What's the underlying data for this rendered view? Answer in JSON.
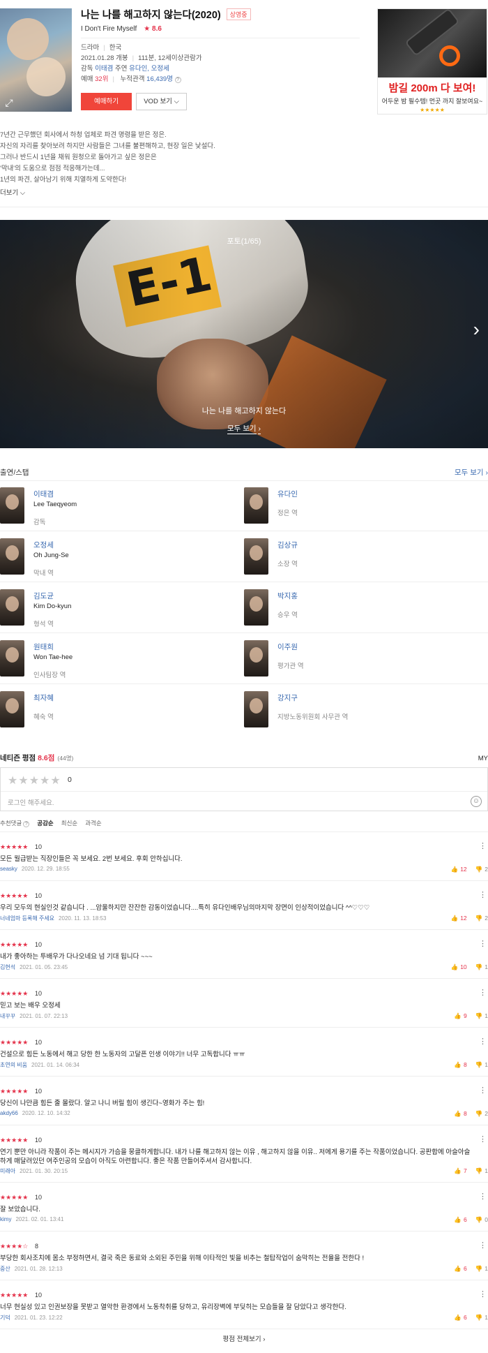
{
  "movie": {
    "title": "나는 나를 해고하지 않는다(2020)",
    "status_badge": "상영중",
    "original_title": "I Don't Fire Myself",
    "rating_star": "★",
    "rating": "8.6",
    "genre": "드라마",
    "country": "한국",
    "release": "2021.01.28 개봉",
    "runtime_rating": "111분, 12세이상관람가",
    "director_label": "감독",
    "director": "이태겸",
    "cast_label": "주연",
    "cast_names": "유다인, 오정세",
    "booking_label": "예매",
    "booking_rank": "32위",
    "audience_label": "누적관객",
    "audience": "16,439명",
    "help_icon": "?",
    "book_button": "예매하기",
    "vod_button": "VOD 보기",
    "synopsis": [
      "7년간 근무했던 회사에서 하청 업체로 파견 명령을 받은 정은.",
      "자신의 자리를 찾아보려 하지만 사람들은 그녀를 불편해하고, 현장 일은 낯설다.",
      "그러나 반드시 1년을 채워 원청으로 돌아가고 싶은 정은은",
      "'막내'의 도움으로 점점 적응해가는데...",
      "1년의 파견, 살아남기 위해 치열하게 도약한다!"
    ],
    "more_link": "더보기"
  },
  "ad": {
    "headline": "밤길 200m 다 보여!",
    "sub": "어두운 밤 필수템! 먼곳 까지 잘보여요~",
    "stars": "★★★★★"
  },
  "photo": {
    "counter": "포토(1/65)",
    "caption": "나는 나를 해고하지 않는다",
    "view_all": "모두 보기",
    "next_icon": "›"
  },
  "cast_section": {
    "title": "출연/스탭",
    "view_all": "모두 보기",
    "people": [
      {
        "name": "이태겸",
        "en": "Lee Taeqyeom",
        "role": "감독"
      },
      {
        "name": "유다인",
        "en": "",
        "role": "정은 역"
      },
      {
        "name": "오정세",
        "en": "Oh Jung-Se",
        "role": "막내 역"
      },
      {
        "name": "김상규",
        "en": "",
        "role": "소장 역"
      },
      {
        "name": "김도균",
        "en": "Kim Do-kyun",
        "role": "형석 역"
      },
      {
        "name": "박지홍",
        "en": "",
        "role": "승우 역"
      },
      {
        "name": "원태희",
        "en": "Won Tae-hee",
        "role": "인사팀장 역"
      },
      {
        "name": "이주원",
        "en": "",
        "role": "평가관 역"
      },
      {
        "name": "최자혜",
        "en": "",
        "role": "혜숙 역"
      },
      {
        "name": "강지구",
        "en": "",
        "role": "지방노동위원회 사무관 역"
      }
    ]
  },
  "reviews_section": {
    "title": "네티즌 평점",
    "score": "8.6점",
    "count": "(44명)",
    "my": "MY",
    "input_stars": "★★★★★",
    "input_score": "0",
    "placeholder": "로그인 해주세요.",
    "sort_label": "추천댓글",
    "sort_help": "?",
    "sort_options": [
      "공감순",
      "최신순",
      "과격순"
    ],
    "footer_link": "평점 전체보기",
    "reviews": [
      {
        "stars": "★★★★★",
        "score": "10",
        "text": "모든 월급받는 직장인들은 꼭 보세요. 2번 보세요. 후회 안하십니다.",
        "author": "seasky",
        "date": "2020. 12. 29. 18:55",
        "up": "12",
        "down": "2"
      },
      {
        "stars": "★★★★★",
        "score": "10",
        "text": "우리 모두의 현실인것 같습니다 . ...암울하지만 잔잔한 감동이었습니다....특히 유다인배우님의마지막 장면이 인상적이었습니다 ^^♡♡♡",
        "author": "너네엄마 등록해 주세요",
        "date": "2020. 11. 13. 18:53",
        "up": "12",
        "down": "2"
      },
      {
        "stars": "★★★★★",
        "score": "10",
        "text": "내가 좋아하는 투배우가 다나오네요 넘 기대 됩니다 ~~~",
        "author": "김현석",
        "date": "2021. 01. 05. 23:45",
        "up": "10",
        "down": "1"
      },
      {
        "stars": "★★★★★",
        "score": "10",
        "text": "믿고 보는 배우 오정세",
        "author": "내꾸꾸",
        "date": "2021. 01. 07. 22:13",
        "up": "9",
        "down": "1"
      },
      {
        "stars": "★★★★★",
        "score": "10",
        "text": "건설으로 힘든 노동에서 해고 당한 한 노동자의 고달픈 인생 이야기!! 너무 고독합니다 ㅠㅠ",
        "author": "초연의 비움",
        "date": "2021. 01. 14. 06:34",
        "up": "8",
        "down": "1"
      },
      {
        "stars": "★★★★★",
        "score": "10",
        "text": "당신이 나만큼 힘든 줄 몰랐다. 알고 나니 버릴 힘이 생긴다~영화가 주는 힘!",
        "author": "akdy66",
        "date": "2020. 12. 10. 14:32",
        "up": "8",
        "down": "2"
      },
      {
        "stars": "★★★★★",
        "score": "10",
        "text": "연기 뿐만 아니라 작품이 주는 메시지가 가슴을 뭉클하게합니다. 내가 나를 해고하지 않는 이유 , 해고하지 않을 이유.. 저에게 용기를 주는 작품이었습니다. 공판합에 아슬아슬하게 매달려있던 여주인공의 모습이 아직도 아련합니다. 좋은 작품 만들어주셔서 감사합니다.",
        "author": "미래아",
        "date": "2021. 01. 30. 20:15",
        "up": "7",
        "down": "1"
      },
      {
        "stars": "★★★★★",
        "score": "10",
        "text": "잘 보았습니다.",
        "author": "kimy",
        "date": "2021. 02. 01. 13:41",
        "up": "6",
        "down": "0"
      },
      {
        "stars": "★★★★☆",
        "score": "8",
        "text": "부당한 회사조치에 몸소 부정하면서, 결국 죽은 동료와 소외된 주민을 위해 이타적인 빛을 비추는 철탑작업이 숨막히는 전율을 전한다 !",
        "author": "중산",
        "date": "2021. 01. 28. 12:13",
        "up": "6",
        "down": "1"
      },
      {
        "stars": "★★★★★",
        "score": "10",
        "text": "너무 현실성 있고 인권보장을 못받고 열악한 환경에서 노동착취를 당하고, 유리장벽에 부딪히는 모습들을 잘 담았다고 생각한다.",
        "author": "기덕",
        "date": "2021. 01. 23. 12:22",
        "up": "6",
        "down": "1"
      }
    ]
  }
}
